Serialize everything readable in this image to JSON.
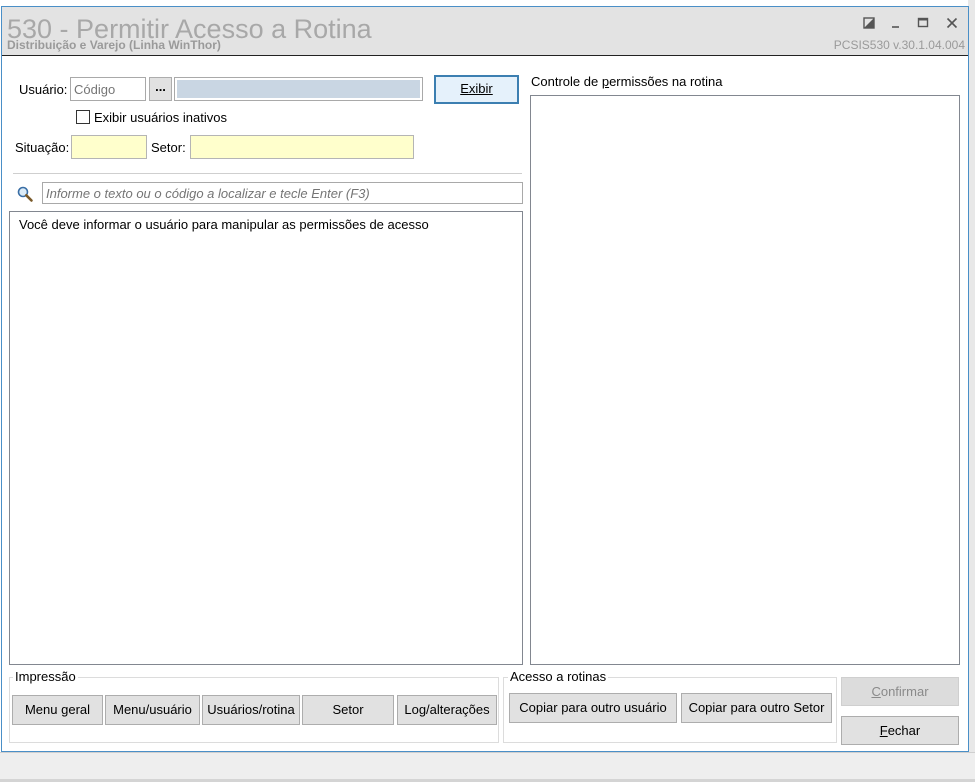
{
  "window": {
    "title": "530 - Permitir Acesso a Rotina",
    "subtitle": "Distribuição e Varejo (Linha WinThor)",
    "version": "PCSIS530  v.30.1.04.004"
  },
  "form": {
    "usuario_label": "Usuário:",
    "codigo_placeholder": "Código",
    "browse_label": "...",
    "exibir_label": "Exibir",
    "exibir_inativos_label": "Exibir usuários inativos",
    "situacao_label": "Situação:",
    "setor_label": "Setor:"
  },
  "search": {
    "placeholder": "Informe o texto ou o código a localizar e tecle Enter (F3)"
  },
  "left_panel": {
    "message": "Você deve informar o usuário para manipular as permissões de acesso"
  },
  "right_panel": {
    "title": "Controle de permissões na rotina"
  },
  "impressao": {
    "title": "Impressão",
    "buttons": [
      "Menu geral",
      "Menu/usuário",
      "Usuários/rotina",
      "Setor",
      "Log/alterações"
    ]
  },
  "acesso": {
    "title": "Acesso a rotinas",
    "buttons": [
      "Copiar para outro usuário",
      "Copiar para outro Setor"
    ]
  },
  "actions": {
    "confirmar": "Confirmar",
    "fechar": "Fechar"
  }
}
